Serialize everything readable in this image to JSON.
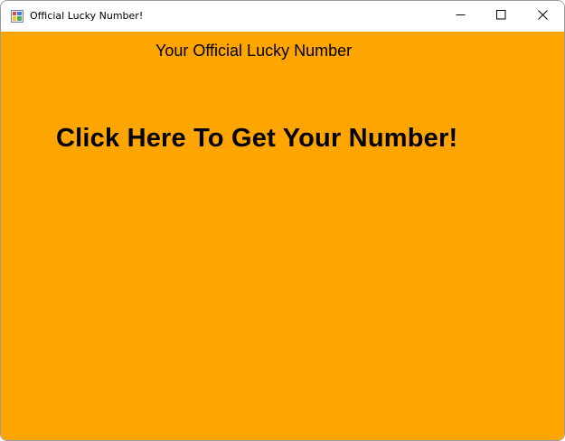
{
  "window": {
    "title": "Official Lucky Number!",
    "icon": "form-app-icon",
    "controls": {
      "minimize_icon": "minimize-icon",
      "maximize_icon": "maximize-icon",
      "close_icon": "close-icon"
    }
  },
  "main": {
    "subtitle": "Your Official Lucky Number",
    "prompt": "Click Here To Get Your Number!",
    "background_color": "#ffa500"
  }
}
